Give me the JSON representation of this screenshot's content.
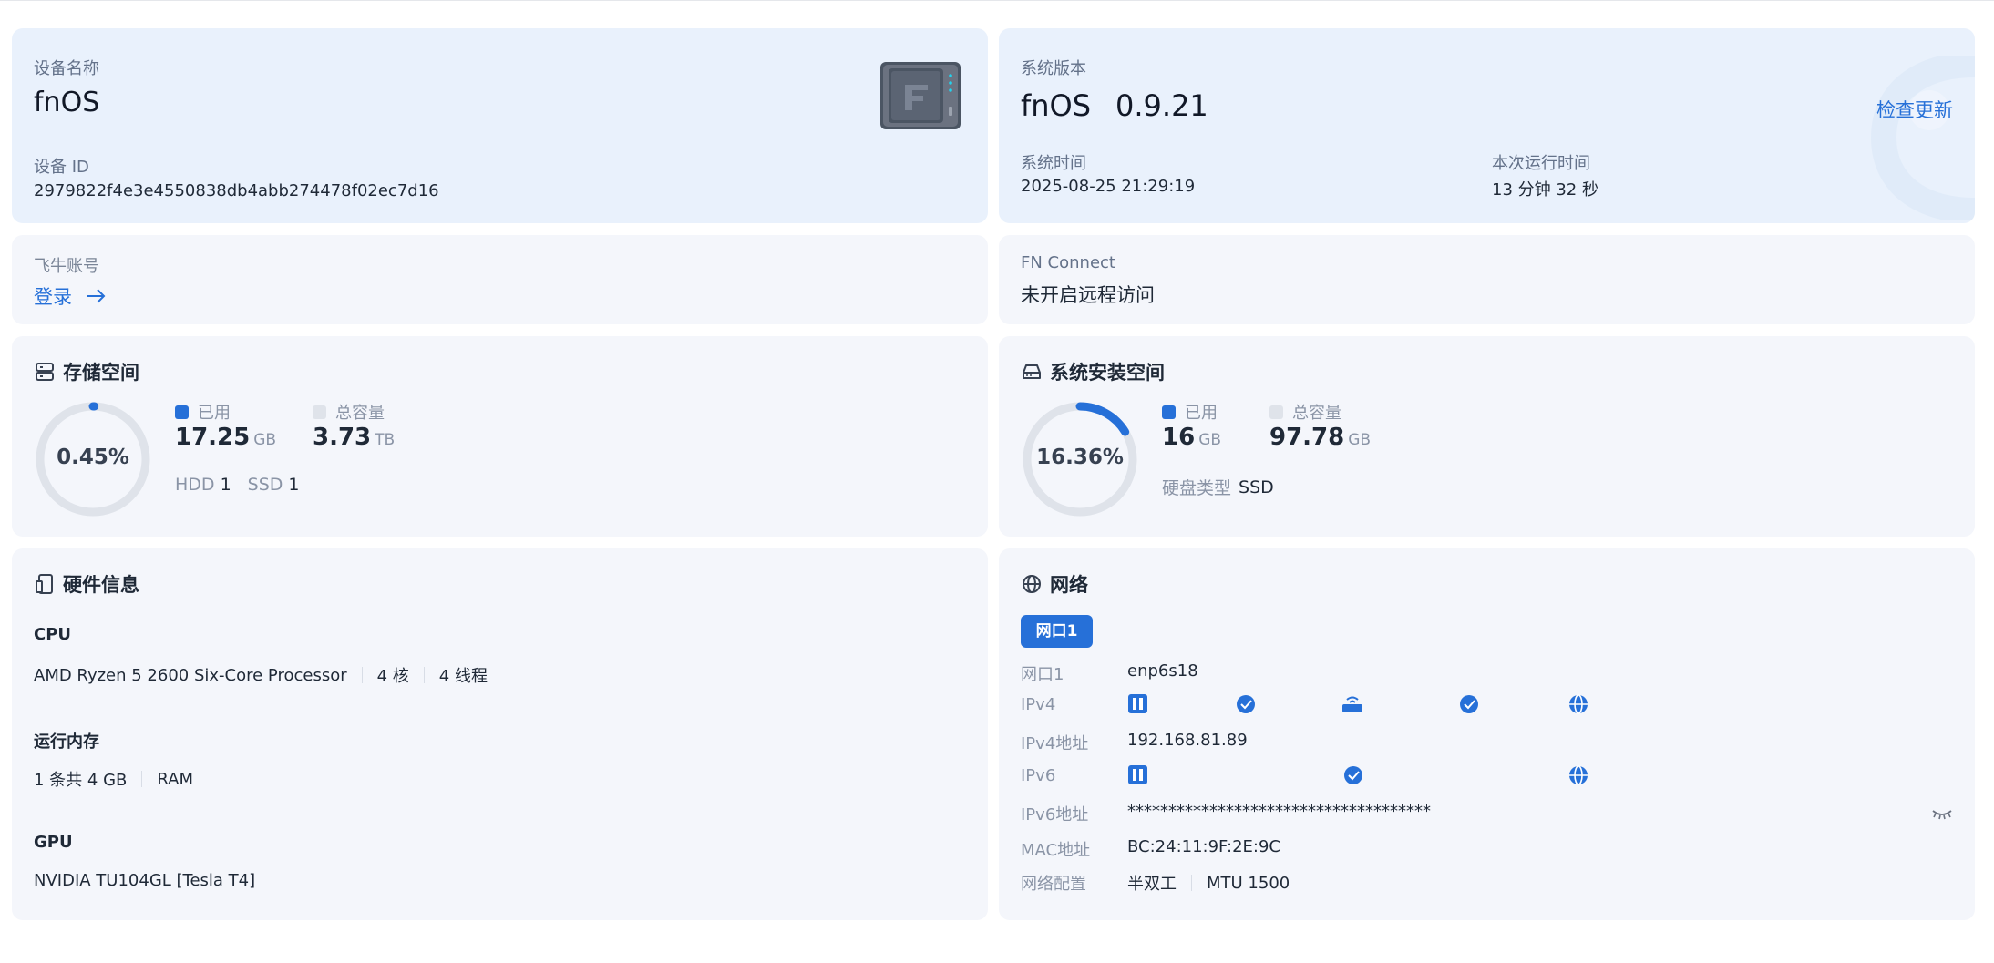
{
  "device": {
    "name_label": "设备名称",
    "name": "fnOS",
    "id_label": "设备 ID",
    "id": "2979822f4e3e4550838db4abb274478f02ec7d16",
    "image_icon": "nas-device-icon"
  },
  "system": {
    "version_label": "系统版本",
    "os_name": "fnOS",
    "version": "0.9.21",
    "check_update": "检查更新",
    "time_label": "系统时间",
    "time": "2025-08-25 21:29:19",
    "uptime_label": "本次运行时间",
    "uptime": "13 分钟 32 秒"
  },
  "account": {
    "label": "飞牛账号",
    "login": "登录"
  },
  "fn_connect": {
    "label": "FN Connect",
    "status": "未开启远程访问"
  },
  "storage": {
    "title": "存储空间",
    "percent_text": "0.45%",
    "percent": 0.45,
    "used_label": "已用",
    "used_value": "17.25",
    "used_unit": "GB",
    "total_label": "总容量",
    "total_value": "3.73",
    "total_unit": "TB",
    "hdd_label": "HDD",
    "hdd_count": "1",
    "ssd_label": "SSD",
    "ssd_count": "1"
  },
  "sys_storage": {
    "title": "系统安装空间",
    "percent_text": "16.36%",
    "percent": 16.36,
    "used_label": "已用",
    "used_value": "16",
    "used_unit": "GB",
    "total_label": "总容量",
    "total_value": "97.78",
    "total_unit": "GB",
    "disk_type_label": "硬盘类型",
    "disk_type": "SSD"
  },
  "hardware": {
    "title": "硬件信息",
    "cpu_label": "CPU",
    "cpu_model": "AMD Ryzen 5 2600 Six-Core Processor",
    "cpu_cores": "4 核",
    "cpu_threads": "4 线程",
    "ram_label": "运行内存",
    "ram_desc": "1 条共 4 GB",
    "ram_type": "RAM",
    "gpu_label": "GPU",
    "gpu_model": "NVIDIA TU104GL [Tesla T4]"
  },
  "network": {
    "title": "网络",
    "tab": "网口1",
    "port_label": "网口1",
    "port_value": "enp6s18",
    "ipv4_label": "IPv4",
    "ipv4_addr_label": "IPv4地址",
    "ipv4_addr": "192.168.81.89",
    "ipv6_label": "IPv6",
    "ipv6_addr_label": "IPv6地址",
    "ipv6_addr": "*************************************",
    "mac_label": "MAC地址",
    "mac": "BC:24:11:9F:2E:9C",
    "config_label": "网络配置",
    "duplex": "半双工",
    "mtu": "MTU 1500"
  },
  "colors": {
    "accent": "#2670d8",
    "card_blue": "#e9f1fc",
    "card_gray": "#f4f6fb",
    "ring_track": "#dfe3ea"
  }
}
